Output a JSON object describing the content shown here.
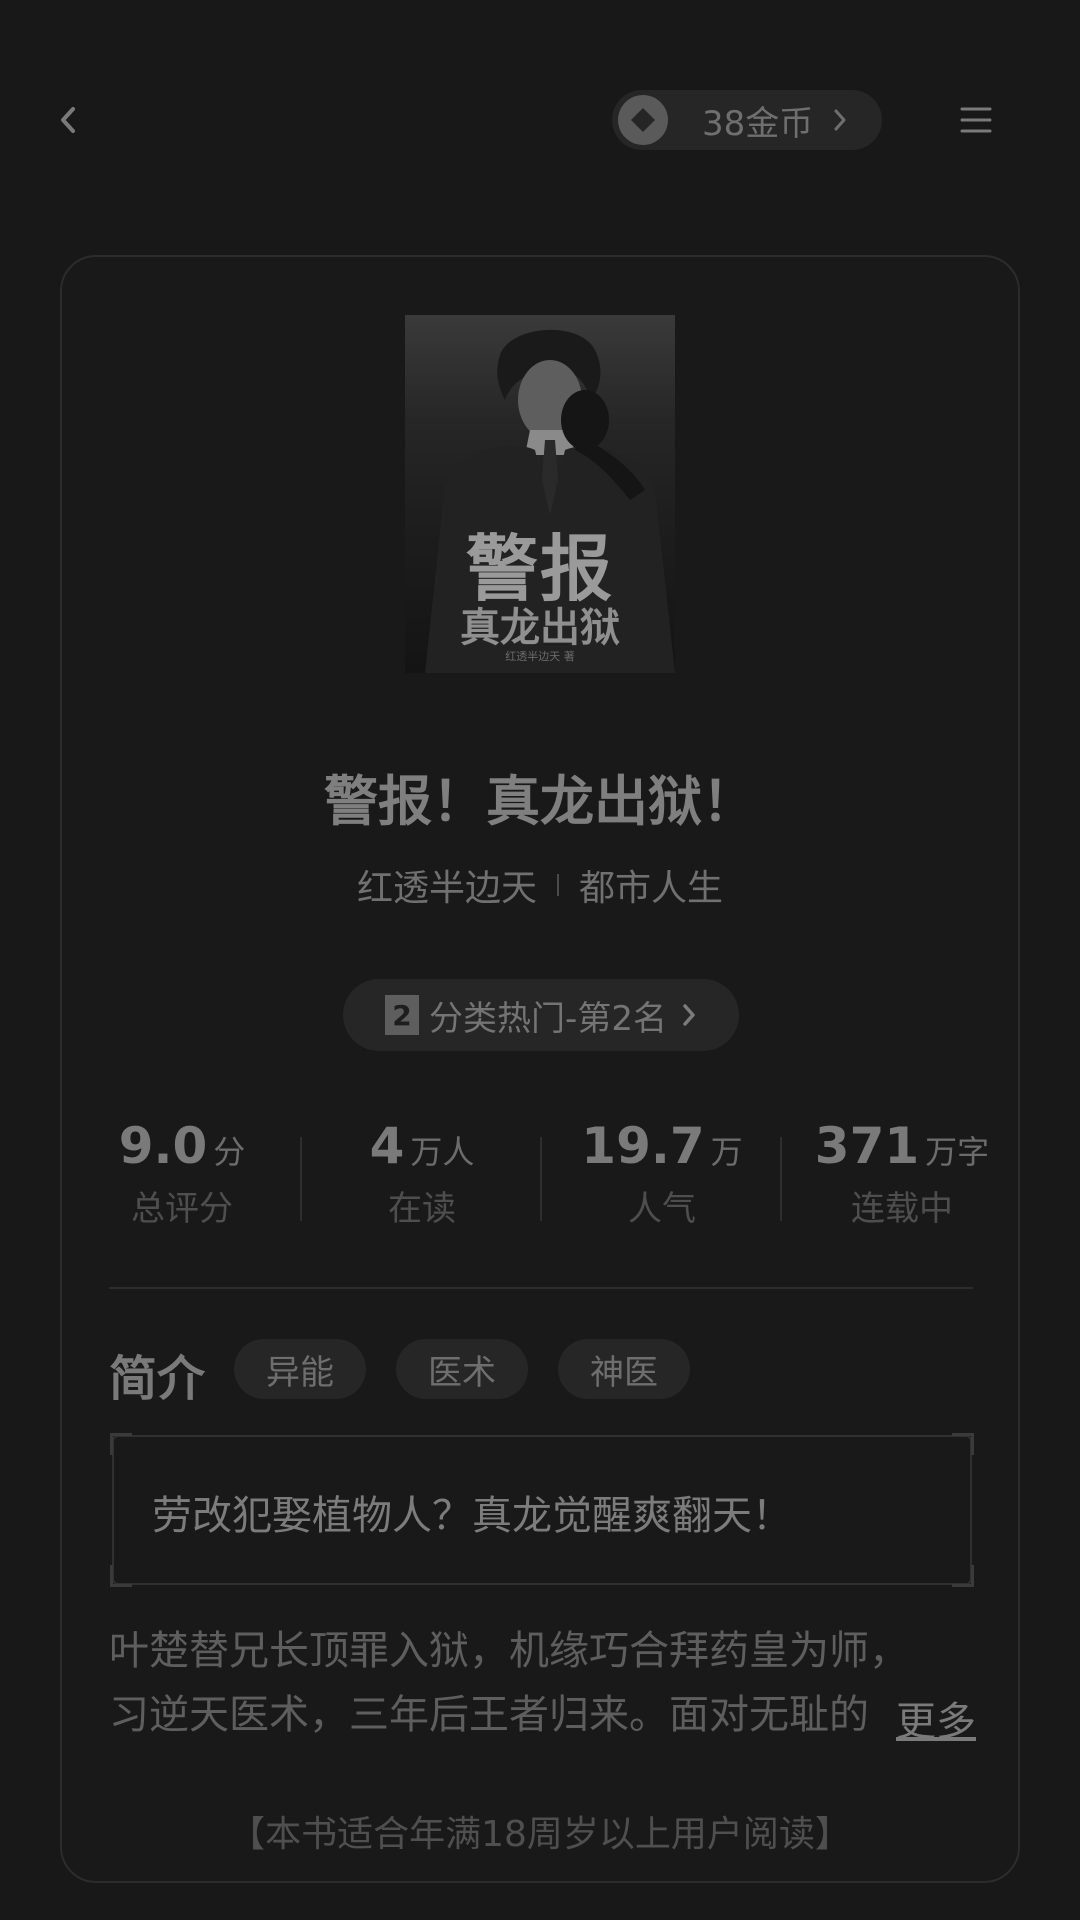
{
  "header": {
    "coins_label": "38金币"
  },
  "cover": {
    "title_line1": "警报",
    "title_line2": "真龙出狱",
    "author_line": "红透半边天 著"
  },
  "book": {
    "title": "警报！真龙出狱！",
    "author": "红透半边天",
    "category": "都市人生"
  },
  "rank": {
    "badge": "2",
    "label": "分类热门-第2名"
  },
  "stats": [
    {
      "value": "9.0",
      "unit": "分",
      "label": "总评分"
    },
    {
      "value": "4",
      "unit": "万人",
      "label": "在读"
    },
    {
      "value": "19.7",
      "unit": "万",
      "label": "人气"
    },
    {
      "value": "371",
      "unit": "万字",
      "label": "连载中"
    }
  ],
  "intro": {
    "label": "简介",
    "tags": [
      "异能",
      "医术",
      "神医"
    ],
    "tagline": "劳改犯娶植物人？真龙觉醒爽翻天！",
    "description_line1": "叶楚替兄长顶罪入狱，机缘巧合拜药皇为师，",
    "description_line2": "习逆天医术，三年后王者归来。面对无耻的",
    "more_label": "更多"
  },
  "notice": "【本书适合年满18周岁以上用户阅读】",
  "colors": {
    "background": "#181818",
    "card": "#191919",
    "pill": "#262626"
  }
}
